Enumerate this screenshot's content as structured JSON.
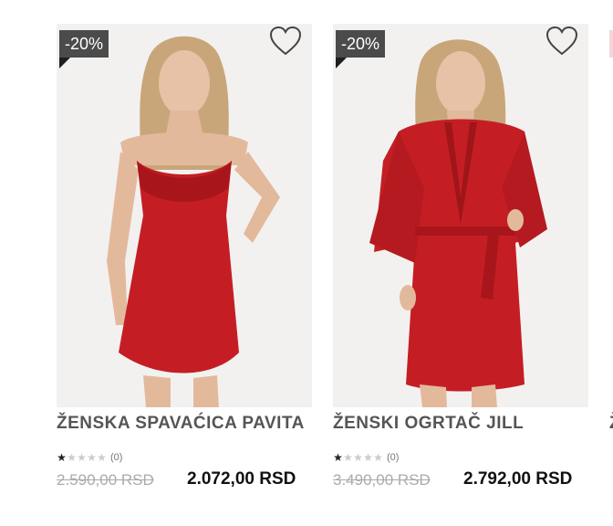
{
  "products": [
    {
      "badge": "-20%",
      "title": "ŽENSKA SPAVAĆICA PAVITA",
      "rating_count": "(0)",
      "old_price": "2.590,00 RSD",
      "price": "2.072,00 RSD",
      "stars_filled": 1,
      "stars_total": 5
    },
    {
      "badge": "-20%",
      "title": "ŽENSKI OGRTAČ JILL",
      "rating_count": "(0)",
      "old_price": "3.490,00 RSD",
      "price": "2.792,00 RSD",
      "stars_filled": 1,
      "stars_total": 5
    }
  ],
  "partial_product": {
    "title_fragment": "Ž"
  },
  "colors": {
    "accent": "#c41e24",
    "badge_bg": "#4b4b4b",
    "title": "#555555",
    "old_price": "#aaaaaa"
  },
  "icons": {
    "wishlist": "heart-outline-icon",
    "star": "star-icon"
  }
}
